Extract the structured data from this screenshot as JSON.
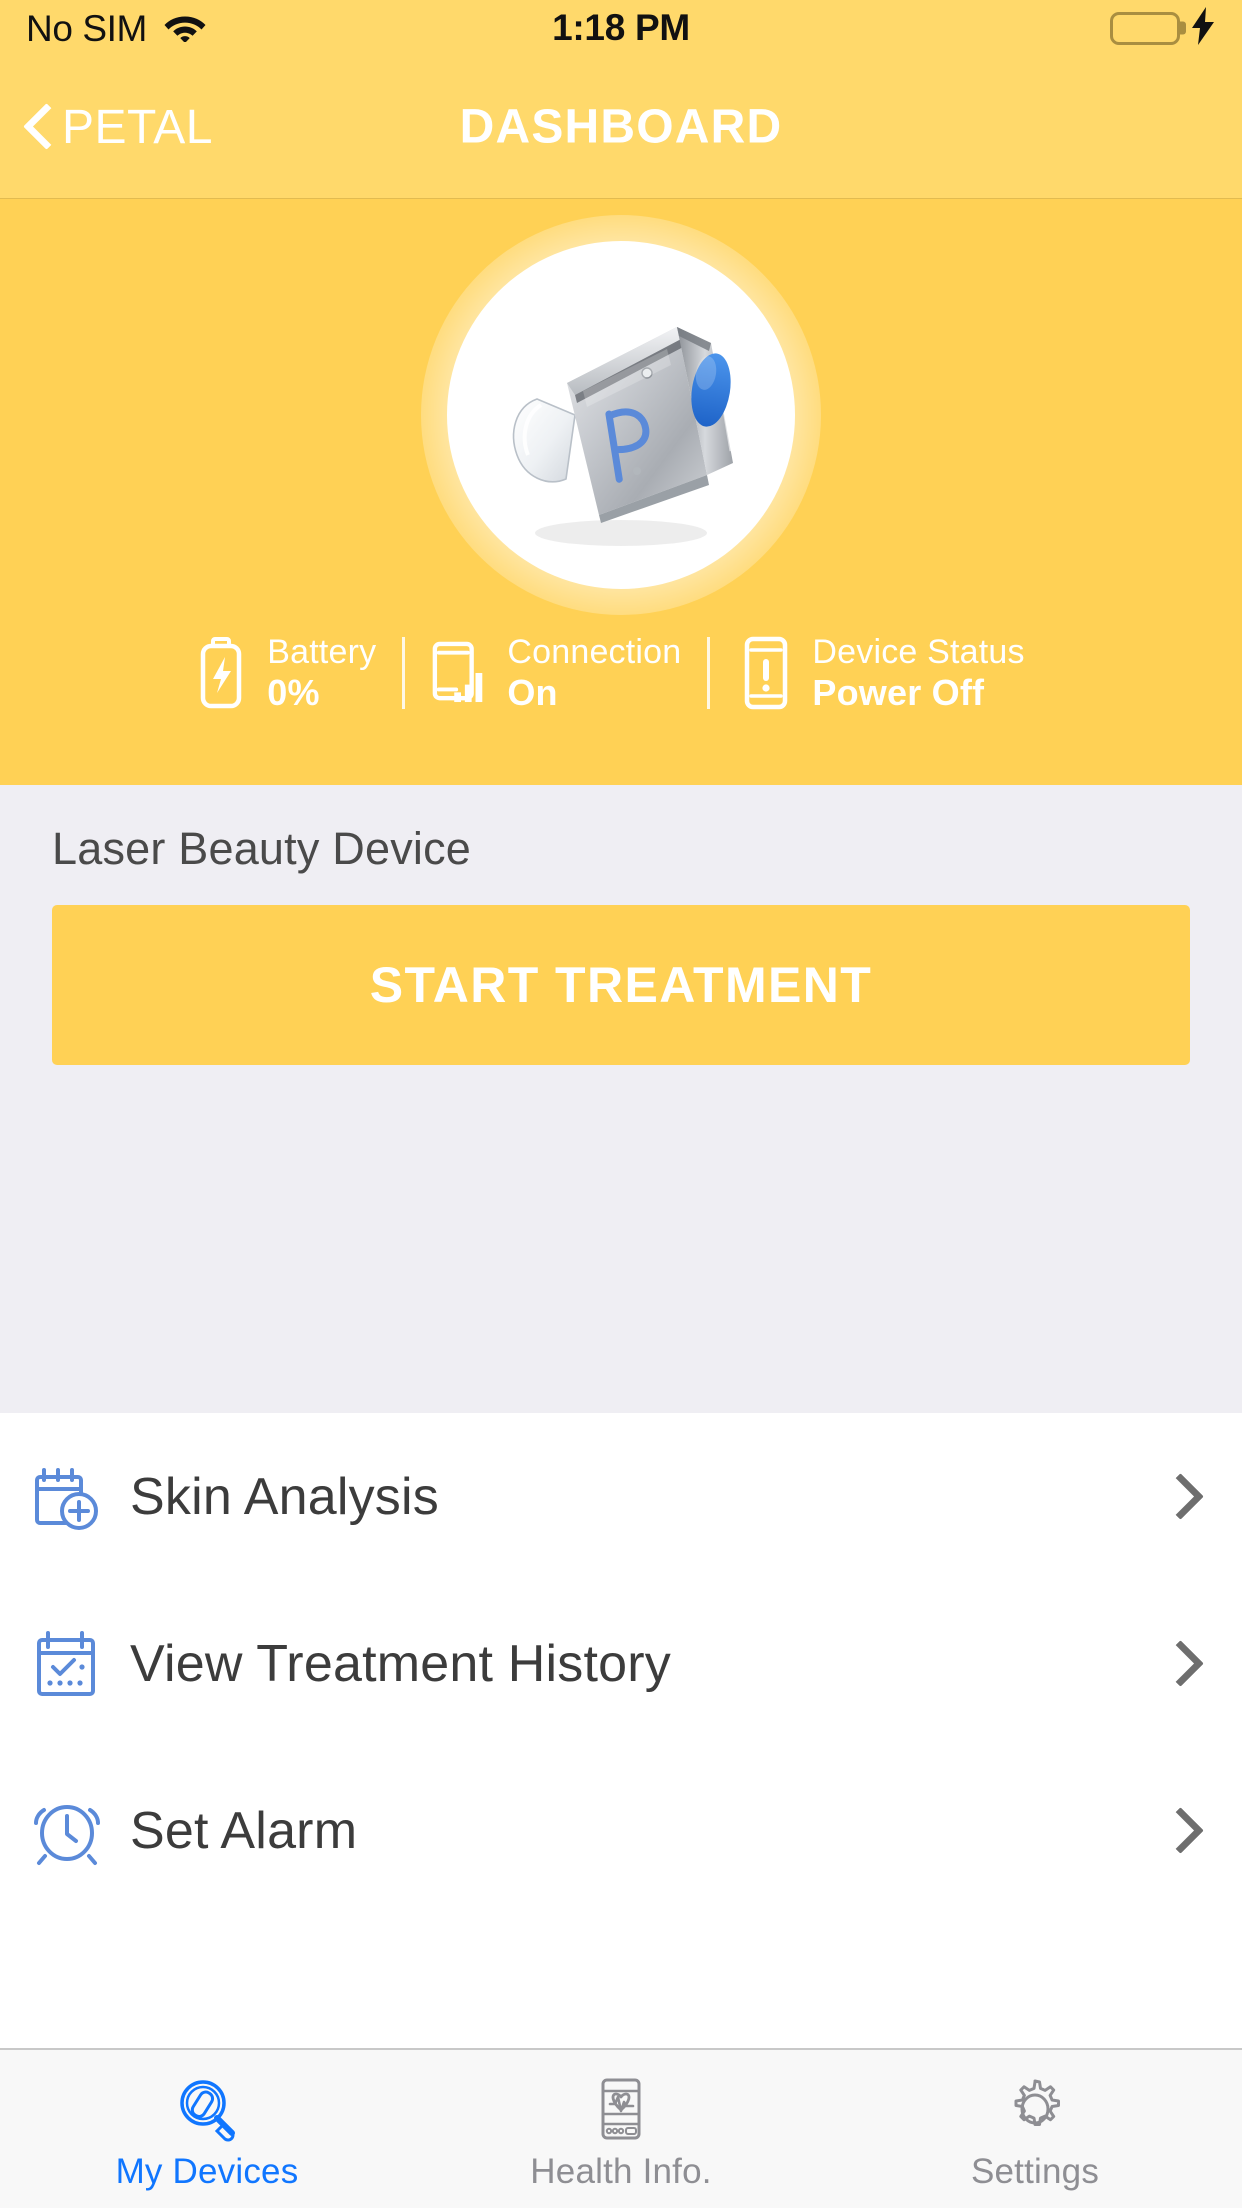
{
  "status_bar": {
    "carrier": "No SIM",
    "wifi_icon": "wifi-icon",
    "time": "1:18 PM",
    "battery_icon": "battery-full-icon",
    "charging_icon": "lightning-bolt-icon",
    "battery_level_percent": 100,
    "battery_color": "#4cd964"
  },
  "nav_bar": {
    "back_icon": "chevron-left-icon",
    "back_label": "PETAL",
    "title": "DASHBOARD",
    "background_color": "#ffd96b"
  },
  "hero": {
    "background_color": "#ffd155",
    "device_image": {
      "icon": "laser-beauty-device-image",
      "body_color": "#b9bcc0",
      "logo_letter": "P",
      "logo_color": "#5b8ad9",
      "button_color": "#2f7fe0"
    },
    "stats": [
      {
        "icon": "battery-charging-icon",
        "label": "Battery",
        "value": "0%"
      },
      {
        "icon": "device-signal-icon",
        "label": "Connection",
        "value": "On"
      },
      {
        "icon": "device-alert-icon",
        "label": "Device Status",
        "value": "Power Off"
      }
    ]
  },
  "treatment": {
    "background_color": "#efeef3",
    "device_name": "Laser Beauty Device",
    "start_button_label": "START TREATMENT",
    "start_button_color": "#ffd155"
  },
  "menu": {
    "items": [
      {
        "icon": "calendar-plus-icon",
        "label": "Skin Analysis",
        "chevron": "chevron-right-icon"
      },
      {
        "icon": "calendar-check-icon",
        "label": "View Treatment History",
        "chevron": "chevron-right-icon"
      },
      {
        "icon": "alarm-clock-icon",
        "label": "Set Alarm",
        "chevron": "chevron-right-icon"
      }
    ],
    "icon_color": "#5b8ad9"
  },
  "tab_bar": {
    "active_color": "#1076ff",
    "inactive_color": "#8e8e93",
    "tabs": [
      {
        "icon": "device-search-icon",
        "label": "My Devices",
        "active": true
      },
      {
        "icon": "health-monitor-icon",
        "label": "Health Info.",
        "active": false
      },
      {
        "icon": "gear-icon",
        "label": "Settings",
        "active": false
      }
    ]
  }
}
